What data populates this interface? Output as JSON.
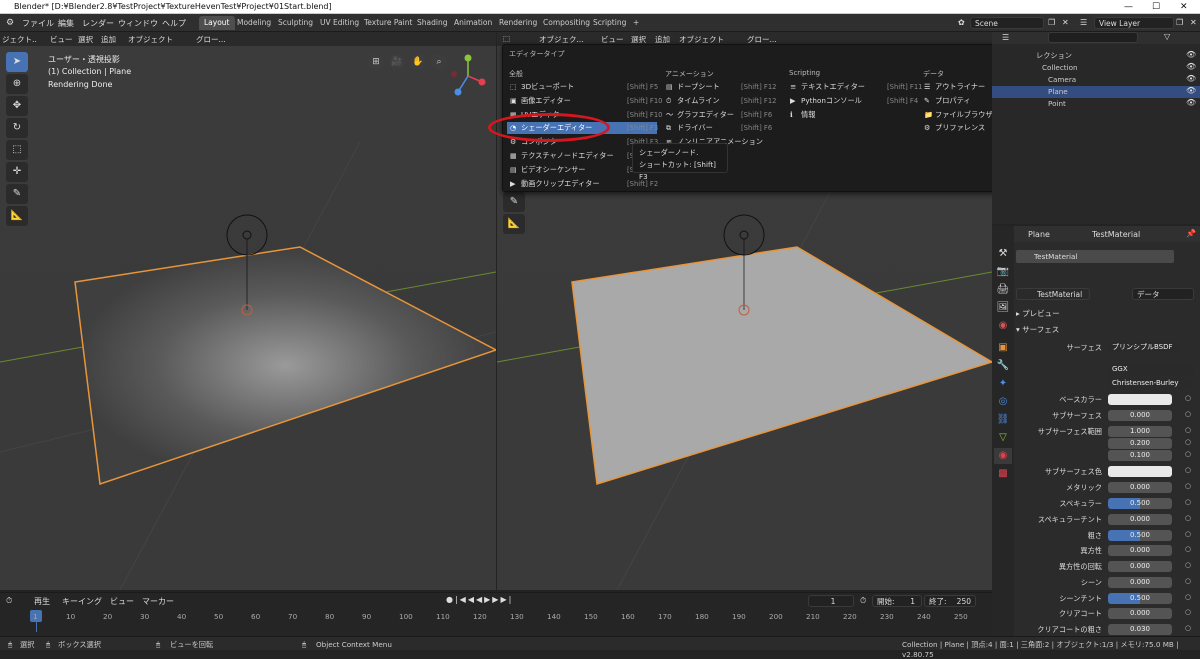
{
  "window": {
    "title": "Blender* [D:¥Blender2.8¥TestProject¥TextureHevenTest¥Project¥01Start.blend]",
    "controls": [
      "—",
      "☐",
      "✕"
    ]
  },
  "topbar": {
    "menus": [
      "ファイル",
      "編集",
      "レンダー",
      "ウィンドウ",
      "ヘルプ"
    ],
    "workspaces": [
      "Layout",
      "Modeling",
      "Sculpting",
      "UV Editing",
      "Texture Paint",
      "Shading",
      "Animation",
      "Rendering",
      "Compositing",
      "Scripting",
      "+"
    ],
    "scene": "Scene",
    "view_layer": "View Layer"
  },
  "left_viewport": {
    "header": [
      "ジェクト..",
      "ビュー",
      "選択",
      "追加",
      "オブジェクト",
      "グロー..."
    ],
    "overlay": [
      "ユーザー・透視投影",
      "(1) Collection | Plane",
      "Rendering Done"
    ]
  },
  "right_viewport": {
    "header": [
      "オブジェク...",
      "ビュー",
      "選択",
      "追加",
      "オブジェクト",
      "グロー..."
    ]
  },
  "editor_popup": {
    "title": "エディタータイプ",
    "columns": [
      {
        "header": "全般",
        "items": [
          [
            "3Dビューポート",
            "[Shift] F5"
          ],
          [
            "画像エディター",
            "[Shift] F10"
          ],
          [
            "UVエディター",
            "[Shift] F10"
          ],
          [
            "シェーダーエディター",
            "[Shift] F3"
          ],
          [
            "コンポジター",
            "[Shift] F3"
          ],
          [
            "テクスチャノードエディター",
            "[Shift] F3"
          ],
          [
            "ビデオシーケンサー",
            "[Shift] F8"
          ],
          [
            "動画クリップエディター",
            "[Shift] F2"
          ]
        ]
      },
      {
        "header": "アニメーション",
        "items": [
          [
            "ドープシート",
            "[Shift] F12"
          ],
          [
            "タイムライン",
            "[Shift] F12"
          ],
          [
            "グラフエディター",
            "[Shift] F6"
          ],
          [
            "ドライバー",
            "[Shift] F6"
          ],
          [
            "ノンリニアアニメーション",
            ""
          ]
        ]
      },
      {
        "header": "Scripting",
        "items": [
          [
            "テキストエディター",
            "[Shift] F11"
          ],
          [
            "Pythonコンソール",
            "[Shift] F4"
          ],
          [
            "情報",
            ""
          ]
        ]
      },
      {
        "header": "データ",
        "items": [
          [
            "アウトライナー",
            "[Shift] F9"
          ],
          [
            "プロパティ",
            "[Shift] F7"
          ],
          [
            "ファイルブラウザー",
            "[Shift] F1"
          ],
          [
            "プリファレンス",
            ""
          ]
        ]
      }
    ],
    "selected": "シェーダーエディター",
    "tooltip": [
      "シェーダーノード.",
      "ショートカット: [Shift] F3"
    ]
  },
  "outliner": {
    "rows": [
      "レクション",
      "Collection",
      "Camera",
      "Plane",
      "Point"
    ]
  },
  "properties": {
    "object": "Plane",
    "material": "TestMaterial",
    "slot": "TestMaterial",
    "data_mode": "データ",
    "sections": [
      "プレビュー",
      "サーフェス"
    ],
    "surface": "プリンシプルBSDF",
    "distribution": "GGX",
    "sss_method": "Christensen-Burley",
    "rows": [
      {
        "label": "ベースカラー",
        "value": "",
        "kind": "white"
      },
      {
        "label": "サブサーフェス",
        "value": "0.000",
        "kind": "num"
      },
      {
        "label": "サブサーフェス範囲",
        "value": "1.000",
        "kind": "num"
      },
      {
        "label": "",
        "value": "0.200",
        "kind": "num"
      },
      {
        "label": "",
        "value": "0.100",
        "kind": "num"
      },
      {
        "label": "サブサーフェス色",
        "value": "",
        "kind": "white"
      },
      {
        "label": "メタリック",
        "value": "0.000",
        "kind": "num"
      },
      {
        "label": "スペキュラー",
        "value": "0.500",
        "kind": "blue"
      },
      {
        "label": "スペキュラーチント",
        "value": "0.000",
        "kind": "num"
      },
      {
        "label": "粗さ",
        "value": "0.500",
        "kind": "blue"
      },
      {
        "label": "異方性",
        "value": "0.000",
        "kind": "num"
      },
      {
        "label": "異方性の回転",
        "value": "0.000",
        "kind": "num"
      },
      {
        "label": "シーン",
        "value": "0.000",
        "kind": "num"
      },
      {
        "label": "シーンチント",
        "value": "0.500",
        "kind": "blue"
      },
      {
        "label": "クリアコート",
        "value": "0.000",
        "kind": "num"
      },
      {
        "label": "クリアコートの粗さ",
        "value": "0.030",
        "kind": "num"
      }
    ]
  },
  "timeline": {
    "menus": [
      "再生",
      "キーイング",
      "ビュー",
      "マーカー"
    ],
    "current": "1",
    "start_label": "開始:",
    "start": "1",
    "end_label": "終了:",
    "end": "250",
    "ticks": [
      "1",
      "10",
      "20",
      "30",
      "40",
      "50",
      "60",
      "70",
      "80",
      "90",
      "100",
      "110",
      "120",
      "130",
      "140",
      "150",
      "160",
      "170",
      "180",
      "190",
      "200",
      "210",
      "220",
      "230",
      "240",
      "250"
    ]
  },
  "status": {
    "select": "選択",
    "box": "ボックス選択",
    "rotate": "ビューを回転",
    "context": "Object Context Menu",
    "info": "Collection | Plane | 頂点:4 | 面:1 | 三角面:2 | オブジェクト:1/3 | メモリ:75.0 MB | v2.80.75"
  }
}
